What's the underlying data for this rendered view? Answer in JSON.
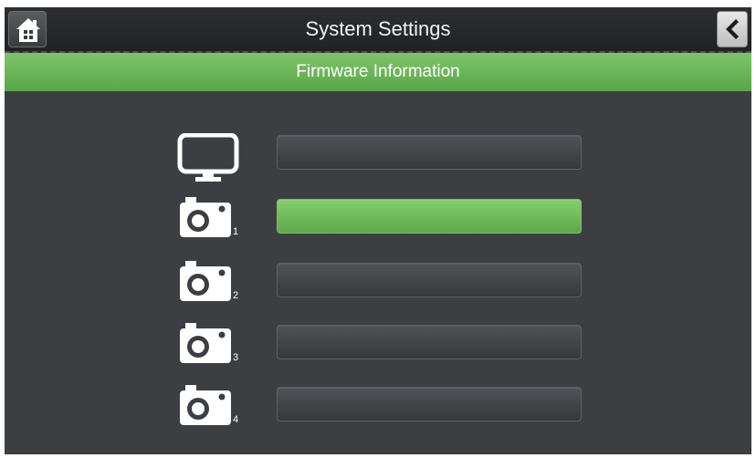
{
  "header": {
    "title": "System Settings",
    "home_icon": "home-icon",
    "back_icon": "chevron-left-icon"
  },
  "section": {
    "title": "Firmware Information"
  },
  "rows": [
    {
      "icon": "monitor-icon",
      "index": "",
      "active": false
    },
    {
      "icon": "camera-icon",
      "index": "1",
      "active": true
    },
    {
      "icon": "camera-icon",
      "index": "2",
      "active": false
    },
    {
      "icon": "camera-icon",
      "index": "3",
      "active": false
    },
    {
      "icon": "camera-icon",
      "index": "4",
      "active": false
    }
  ],
  "colors": {
    "accent_green": "#6bb857",
    "background": "#3c3e42",
    "topbar": "#27282b"
  }
}
